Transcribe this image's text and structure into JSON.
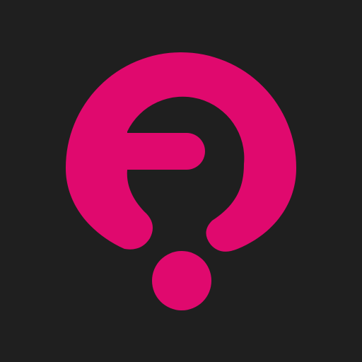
{
  "icon": {
    "name": "question-logo-icon",
    "colors": {
      "background": "#1f1f1f",
      "accent": "#e0096e"
    }
  }
}
